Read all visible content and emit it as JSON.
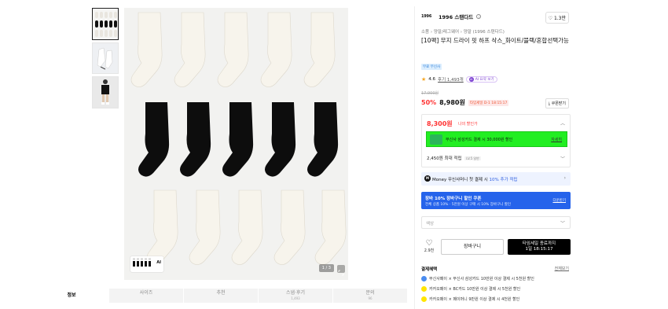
{
  "brand": {
    "logo_text": "1996",
    "name": "1996 스탠다드"
  },
  "like": {
    "count": "1.3만"
  },
  "breadcrumb": [
    "소품",
    "양말/레그웨어",
    "양말 (1996 스탠다드)"
  ],
  "product": {
    "title": "[10팩] 무지 드라이 핏 하프 삭스_화이트/블랙/혼합선택가능",
    "free_shipping_badge": "무료 무신사",
    "rating": "4.6",
    "review_text": "후기 1,493개",
    "ai_label": "AI 요약 보기",
    "original_price": "17,900원",
    "discount": "50%",
    "price": "8,980원",
    "timer_badge": "타임세일 D-1 18:15:17",
    "coupon_label": "쿠폰받기"
  },
  "my_price": {
    "value": "8,300원",
    "label": "나의 할인가",
    "card_text": "무신사 삼성카드 결제 시 30,000원 할인",
    "card_more": "자세히"
  },
  "points": {
    "text": "2,450원 최대 적립",
    "tag": "LV.5 일반"
  },
  "money": {
    "icon": "M",
    "text_prefix": "Money 무신사머니 첫 결제 시 ",
    "highlight": "10% 추가 적립"
  },
  "banner": {
    "line1": "장바 10% 장바구니 할인 쿠폰",
    "line2": "전체 상품 10% · 5만원 이상 구매 시 10% 장바구니 할인",
    "action": "다운받기"
  },
  "option": {
    "placeholder": "색상"
  },
  "actions": {
    "like_count": "2.9천",
    "cart_label": "장바구니",
    "buy_line1": "타임세일 종료까지",
    "buy_line2": "1일 18:15:17"
  },
  "payment": {
    "title": "결제혜택",
    "more": "전체보기",
    "rows": [
      "무신사페이 × 무신사 삼성카드 10만원 이상 결제 시 5천원 할인",
      "카카오페이 × BC카드 10만원 이상 결제 시 5천원 할인",
      "카카오페이 × 페이머니 9만원 이상 결제 시 4천원 할인"
    ]
  },
  "image": {
    "counter": "1 / 3",
    "mini_ai": "AI"
  },
  "tabs": [
    {
      "label": "정보",
      "sub": ""
    },
    {
      "label": "사이즈",
      "sub": ""
    },
    {
      "label": "추천",
      "sub": ""
    },
    {
      "label": "스냅·후기",
      "sub": "1,493"
    },
    {
      "label": "문의",
      "sub": "96"
    }
  ],
  "colors": {
    "accent_red": "#ff3333",
    "green_card": "#22ee22",
    "banner_blue": "#2563eb"
  }
}
